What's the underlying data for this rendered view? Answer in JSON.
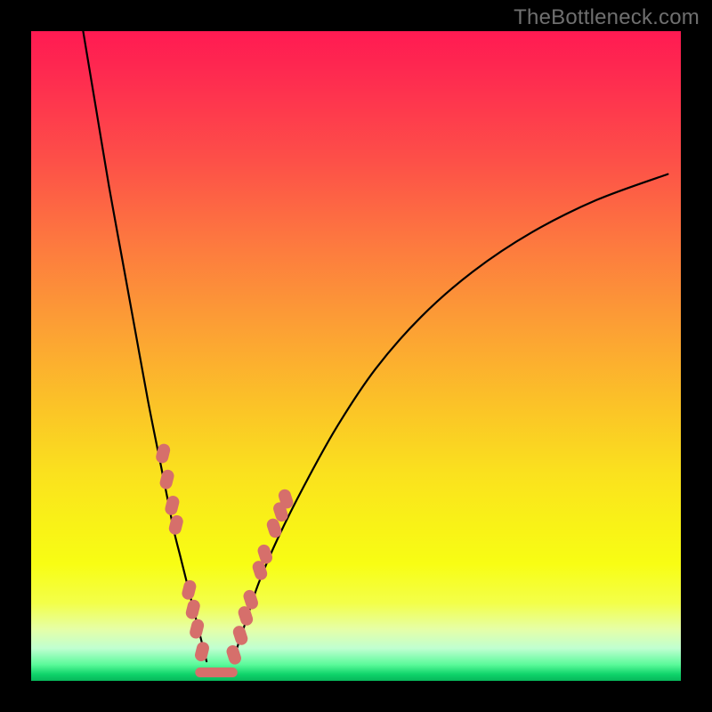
{
  "watermark": "TheBottleneck.com",
  "colors": {
    "frame": "#000000",
    "gradient_top": "#ff1a52",
    "gradient_mid": "#fbe31f",
    "gradient_bottom": "#07b75a",
    "curve": "#000000",
    "dot": "#d66f6b"
  },
  "chart_data": {
    "type": "line",
    "title": "",
    "xlabel": "",
    "ylabel": "",
    "xlim": [
      0,
      100
    ],
    "ylim": [
      0,
      100
    ],
    "series": [
      {
        "name": "left-curve",
        "x": [
          8,
          10,
          12,
          14,
          16,
          18,
          20,
          21,
          22,
          23,
          24,
          25,
          26,
          27
        ],
        "y": [
          100,
          88,
          76,
          65,
          54,
          43,
          33,
          28,
          23,
          19,
          15,
          11,
          7,
          3
        ]
      },
      {
        "name": "right-curve",
        "x": [
          31,
          33,
          35,
          38,
          42,
          47,
          53,
          60,
          68,
          77,
          87,
          98
        ],
        "y": [
          3,
          9,
          15,
          22,
          30,
          39,
          48,
          56,
          63,
          69,
          74,
          78
        ]
      },
      {
        "name": "valley-flat",
        "x": [
          26,
          31
        ],
        "y": [
          1.3,
          1.3
        ]
      }
    ],
    "dots_left": [
      {
        "x": 20.3,
        "y": 35
      },
      {
        "x": 20.9,
        "y": 31
      },
      {
        "x": 21.7,
        "y": 27
      },
      {
        "x": 22.3,
        "y": 24
      },
      {
        "x": 24.3,
        "y": 14
      },
      {
        "x": 24.9,
        "y": 11
      },
      {
        "x": 25.5,
        "y": 8
      },
      {
        "x": 26.3,
        "y": 4.5
      }
    ],
    "dots_right": [
      {
        "x": 31.2,
        "y": 4
      },
      {
        "x": 32.2,
        "y": 7
      },
      {
        "x": 33.0,
        "y": 10
      },
      {
        "x": 33.8,
        "y": 12.5
      },
      {
        "x": 35.2,
        "y": 17
      },
      {
        "x": 36.0,
        "y": 19.5
      },
      {
        "x": 37.4,
        "y": 23.5
      },
      {
        "x": 38.4,
        "y": 26
      },
      {
        "x": 39.2,
        "y": 28
      }
    ]
  }
}
